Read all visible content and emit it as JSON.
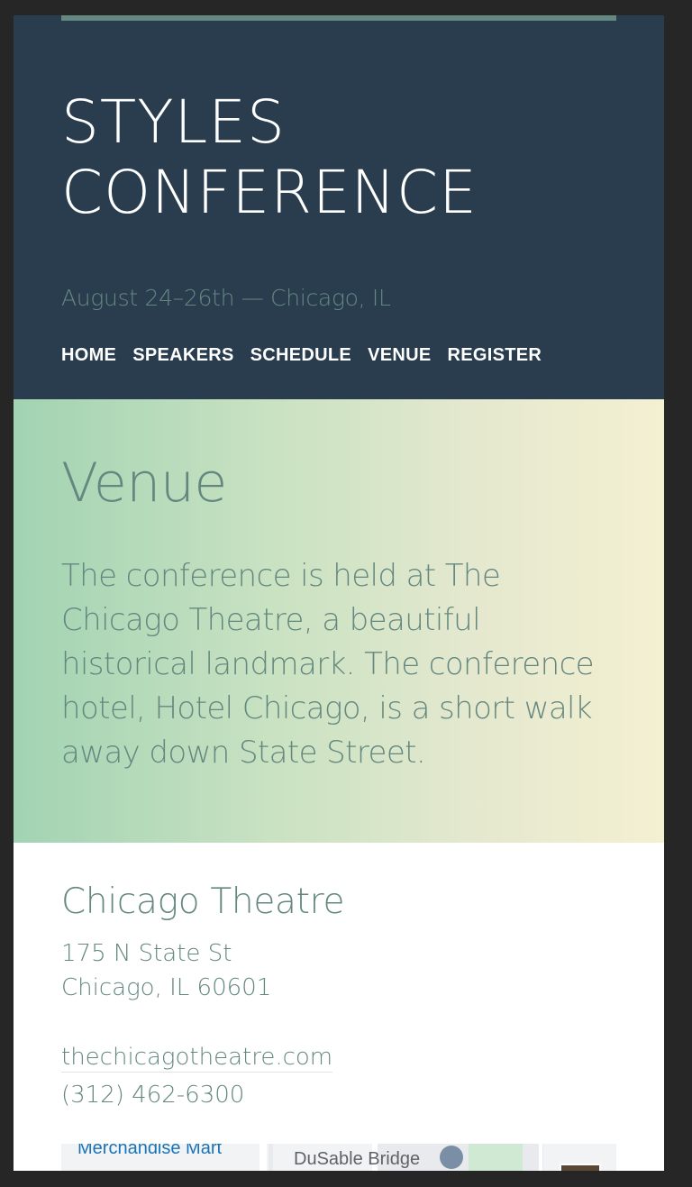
{
  "header": {
    "logo_line1": "STYLES",
    "logo_line2": "CONFERENCE",
    "tagline": "August 24–26th — Chicago, IL",
    "nav": [
      "HOME",
      "SPEAKERS",
      "SCHEDULE",
      "VENUE",
      "REGISTER"
    ]
  },
  "hero": {
    "title": "Venue",
    "description": "The conference is held at The Chicago Theatre, a beautiful historical landmark. The conference hotel, Hotel Chicago, is a short walk away down State Street."
  },
  "venue": {
    "name": "Chicago Theatre",
    "street": "175 N State St",
    "city": "Chicago, IL 60601",
    "website": "thechicagotheatre.com",
    "phone": "(312) 462-6300"
  },
  "map": {
    "label_merchandise": "Merchandise Mart",
    "label_bridge": "DuSable Bridge"
  },
  "colors": {
    "header_bg": "#2a3d4f",
    "accent": "#648880",
    "gradient_start": "#a2d3b2",
    "gradient_end": "#f4f0d2"
  }
}
